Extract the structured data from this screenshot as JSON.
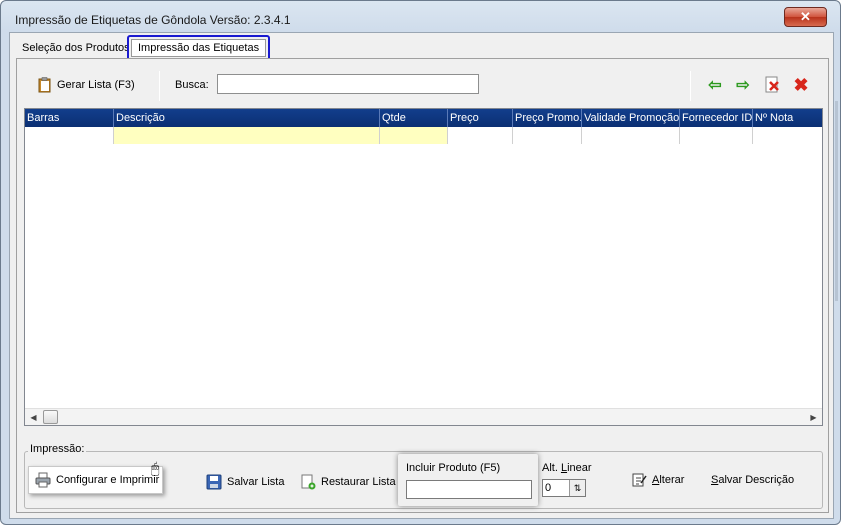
{
  "window": {
    "title": "Impressão de Etiquetas de Gôndola Versão: 2.3.4.1",
    "close_label": "✕"
  },
  "tabs": [
    {
      "label": "Seleção dos Produtos"
    },
    {
      "label": "Impressão das Etiquetas"
    }
  ],
  "toolbar": {
    "gerar_label": "Gerar Lista (F3)",
    "busca_label": "Busca:",
    "busca_value": ""
  },
  "grid": {
    "columns": [
      "Barras",
      "Descrição",
      "Qtde",
      "Preço",
      "Preço Promo.",
      "Validade Promoção",
      "Fornecedor ID",
      "Nº Nota"
    ]
  },
  "impressao": {
    "group_label": "Impressão:",
    "configurar_label": "Configurar e Imprimir",
    "salvar_lista_label": "Salvar Lista",
    "restaurar_lista_label": "Restaurar Lista",
    "incluir_label": "Incluir Produto (F5)",
    "incluir_value": "",
    "alt_linear_prefix": "Alt. ",
    "alt_linear_u": "L",
    "alt_linear_rest": "inear",
    "alt_linear_value": "0",
    "alterar_u": "A",
    "alterar_rest": "lterar",
    "salvar_desc_u": "S",
    "salvar_desc_rest": "alvar Descrição"
  },
  "colors": {
    "header_bg": "#0b2f73",
    "highlight_cell": "#ffffc0",
    "tab_outline": "#1a1ad0"
  }
}
